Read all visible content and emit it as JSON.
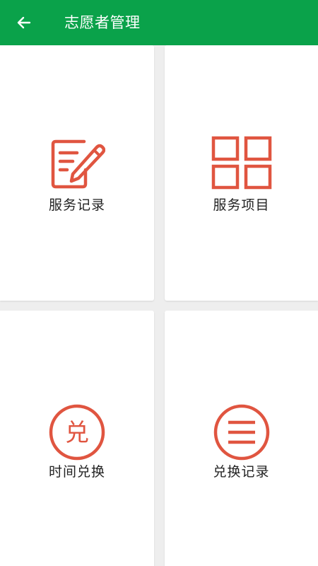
{
  "header": {
    "title": "志愿者管理",
    "back_icon": "arrow-left-icon",
    "background": "#0aa24a"
  },
  "accent_color": "#e05540",
  "menu": [
    {
      "label": "服务记录",
      "icon": "edit-document-icon"
    },
    {
      "label": "服务项目",
      "icon": "grid-icon"
    },
    {
      "label": "时间兑换",
      "icon": "exchange-badge-icon",
      "badge_char": "兑"
    },
    {
      "label": "兑换记录",
      "icon": "list-circle-icon"
    }
  ]
}
